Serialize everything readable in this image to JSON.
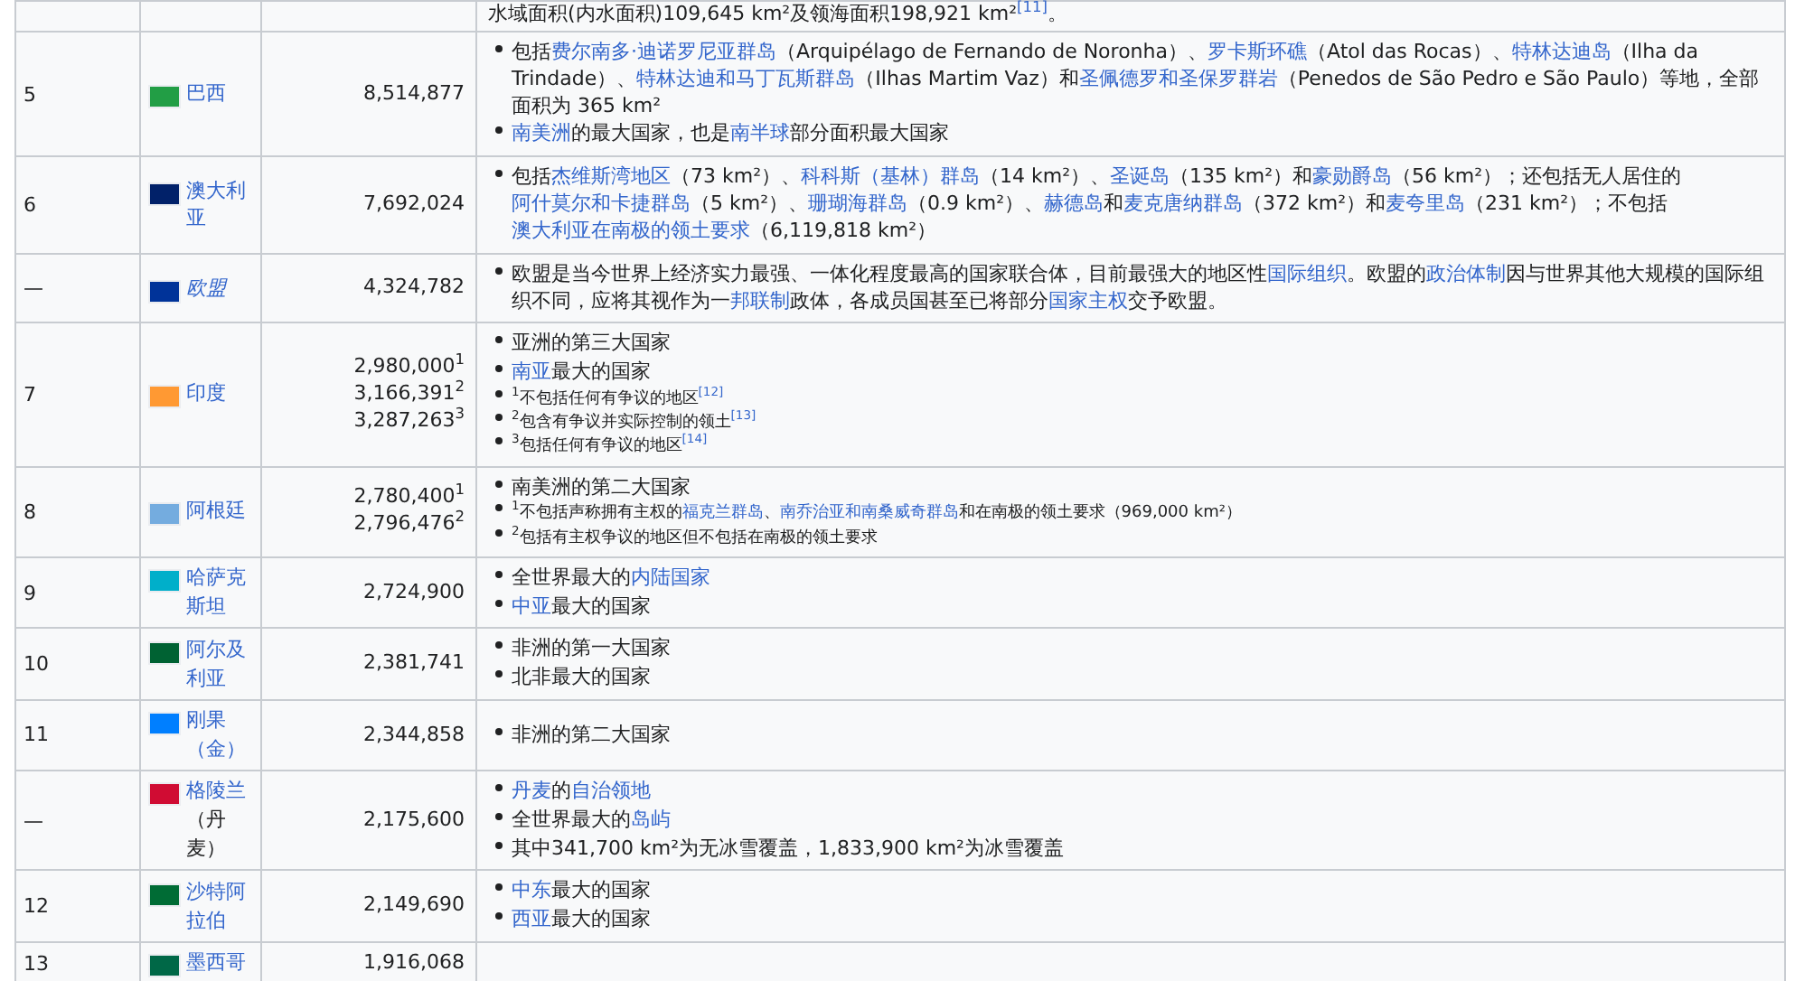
{
  "top_cut": {
    "parts": [
      {
        "text": "水域面积(内水面积)109,645 km²及领海面积198,921 km²",
        "link": false
      },
      {
        "text": "$^{[11]}$",
        "link": true
      },
      {
        "text": "。",
        "link": false
      }
    ]
  },
  "rows": [
    {
      "rank": "5",
      "color": "#229e45",
      "italic": false,
      "name": [
        {
          "text": "巴西",
          "link": true
        }
      ],
      "area": [
        "8,514,877"
      ],
      "notes": [
        {
          "kind": "normal",
          "parts": [
            {
              "text": "包括",
              "link": false
            },
            {
              "text": "费尔南多·迪诺罗尼亚群岛",
              "link": true
            },
            {
              "text": "（Arquipélago de Fernando de Noronha）、",
              "link": false
            },
            {
              "text": "罗卡斯环礁",
              "link": true
            },
            {
              "text": "（Atol das Rocas）、",
              "link": false
            },
            {
              "text": "特林达迪岛",
              "link": true
            },
            {
              "text": "（Ilha da Trindade）、",
              "link": false
            },
            {
              "text": "特林达迪和马丁瓦斯群岛",
              "link": true
            },
            {
              "text": "（Ilhas Martim Vaz）和",
              "link": false
            },
            {
              "text": "圣佩德罗和圣保罗群岩",
              "link": true
            },
            {
              "text": "（Penedos de São Pedro e São Paulo）等地，全部面积为 365 km²",
              "link": false
            }
          ]
        },
        {
          "kind": "normal",
          "parts": [
            {
              "text": "南美洲",
              "link": true
            },
            {
              "text": "的最大国家，也是",
              "link": false
            },
            {
              "text": "南半球",
              "link": true
            },
            {
              "text": "部分面积最大国家",
              "link": false
            }
          ]
        }
      ]
    },
    {
      "rank": "6",
      "color": "#012169",
      "italic": false,
      "name": [
        {
          "text": "澳大利亚",
          "link": true
        }
      ],
      "area": [
        "7,692,024"
      ],
      "notes": [
        {
          "kind": "normal",
          "parts": [
            {
              "text": "包括",
              "link": false
            },
            {
              "text": "杰维斯湾地区",
              "link": true
            },
            {
              "text": "（73 km²）、",
              "link": false
            },
            {
              "text": "科科斯（基林）群岛",
              "link": true
            },
            {
              "text": "（14 km²）、",
              "link": false
            },
            {
              "text": "圣诞岛",
              "link": true
            },
            {
              "text": "（135 km²）和",
              "link": false
            },
            {
              "text": "豪勋爵岛",
              "link": true
            },
            {
              "text": "（56 km²）；还包括无人居住的",
              "link": false
            },
            {
              "text": "阿什莫尔和卡捷群岛",
              "link": true
            },
            {
              "text": "（5 km²）、",
              "link": false
            },
            {
              "text": "珊瑚海群岛",
              "link": true
            },
            {
              "text": "（0.9 km²）、",
              "link": false
            },
            {
              "text": "赫德岛",
              "link": true
            },
            {
              "text": "和",
              "link": false
            },
            {
              "text": "麦克唐纳群岛",
              "link": true
            },
            {
              "text": "（372 km²）和",
              "link": false
            },
            {
              "text": "麦夸里岛",
              "link": true
            },
            {
              "text": "（231 km²）；不包括",
              "link": false
            },
            {
              "text": "澳大利亚在南极的领土要求",
              "link": true
            },
            {
              "text": "（6,119,818 km²）",
              "link": false
            }
          ]
        }
      ]
    },
    {
      "rank": "—",
      "color": "#003399",
      "italic": true,
      "name": [
        {
          "text": "欧盟",
          "link": true
        }
      ],
      "area": [
        "4,324,782"
      ],
      "notes": [
        {
          "kind": "normal",
          "parts": [
            {
              "text": "欧盟是当今世界上经济实力最强、一体化程度最高的国家联合体，目前最强大的地区性",
              "link": false
            },
            {
              "text": "国际组织",
              "link": true
            },
            {
              "text": "。欧盟的",
              "link": false
            },
            {
              "text": "政治体制",
              "link": true
            },
            {
              "text": "因与世界其他大规模的国际组织不同，应将其视作为一",
              "link": false
            },
            {
              "text": "邦联制",
              "link": true
            },
            {
              "text": "政体，各成员国甚至已将部分",
              "link": false
            },
            {
              "text": "国家主权",
              "link": true
            },
            {
              "text": "交予欧盟。",
              "link": false
            }
          ]
        }
      ]
    },
    {
      "rank": "7",
      "color": "#ff9933",
      "italic": false,
      "name": [
        {
          "text": "印度",
          "link": true
        }
      ],
      "area": [
        "2,980,000$^{1}$",
        "3,166,391$^{2}$",
        "3,287,263$^{3}$"
      ],
      "notes": [
        {
          "kind": "normal",
          "parts": [
            {
              "text": "亚洲的第三大国家",
              "link": false
            }
          ]
        },
        {
          "kind": "normal",
          "parts": [
            {
              "text": "南亚",
              "link": true
            },
            {
              "text": "最大的国家",
              "link": false
            }
          ]
        },
        {
          "kind": "small",
          "parts": [
            {
              "text": "$^{1}$不包括任何有争议的地区",
              "link": false
            },
            {
              "text": "$^{[12]}$",
              "link": true
            }
          ]
        },
        {
          "kind": "small",
          "parts": [
            {
              "text": "$^{2}$包含有争议并实际控制的领土",
              "link": false
            },
            {
              "text": "$^{[13]}$",
              "link": true
            }
          ]
        },
        {
          "kind": "small",
          "parts": [
            {
              "text": "$^{3}$包括任何有争议的地区",
              "link": false
            },
            {
              "text": "$^{[14]}$",
              "link": true
            }
          ]
        }
      ]
    },
    {
      "rank": "8",
      "color": "#74acdf",
      "italic": false,
      "name": [
        {
          "text": "阿根廷",
          "link": true
        }
      ],
      "area": [
        "2,780,400$^{1}$",
        "2,796,476$^{2}$"
      ],
      "notes": [
        {
          "kind": "normal",
          "parts": [
            {
              "text": "南美洲的第二大国家",
              "link": false
            }
          ]
        },
        {
          "kind": "small",
          "parts": [
            {
              "text": "$^{1}$不包括声称拥有主权的",
              "link": false
            },
            {
              "text": "福克兰群岛",
              "link": true
            },
            {
              "text": "、",
              "link": false
            },
            {
              "text": "南乔治亚和南桑威奇群岛",
              "link": true
            },
            {
              "text": "和在南极的领土要求（969,000 km²）",
              "link": false
            }
          ]
        },
        {
          "kind": "small",
          "parts": [
            {
              "text": "$^{2}$包括有主权争议的地区但不包括在南极的领土要求",
              "link": false
            }
          ]
        }
      ]
    },
    {
      "rank": "9",
      "color": "#00afca",
      "italic": false,
      "name": [
        {
          "text": "哈萨克斯坦",
          "link": true
        }
      ],
      "area": [
        "2,724,900"
      ],
      "notes": [
        {
          "kind": "normal",
          "parts": [
            {
              "text": "全世界最大的",
              "link": false
            },
            {
              "text": "内陆国家",
              "link": true
            }
          ]
        },
        {
          "kind": "normal",
          "parts": [
            {
              "text": "中亚",
              "link": true
            },
            {
              "text": "最大的国家",
              "link": false
            }
          ]
        }
      ]
    },
    {
      "rank": "10",
      "color": "#006233",
      "italic": false,
      "name": [
        {
          "text": "阿尔及利亚",
          "link": true
        }
      ],
      "area": [
        "2,381,741"
      ],
      "notes": [
        {
          "kind": "normal",
          "parts": [
            {
              "text": "非洲的第一大国家",
              "link": false
            }
          ]
        },
        {
          "kind": "normal",
          "parts": [
            {
              "text": "北非最大的国家",
              "link": false
            }
          ]
        }
      ]
    },
    {
      "rank": "11",
      "color": "#007fff",
      "italic": false,
      "name": [
        {
          "text": "刚果（金）",
          "link": true
        }
      ],
      "area": [
        "2,344,858"
      ],
      "notes": [
        {
          "kind": "normal",
          "parts": [
            {
              "text": "非洲的第二大国家",
              "link": false
            }
          ]
        }
      ]
    },
    {
      "rank": "—",
      "color": "#d00c33",
      "italic": false,
      "name": [
        {
          "text": "格陵兰",
          "link": true
        },
        {
          "text": "（丹麦）",
          "link": false
        }
      ],
      "area": [
        "2,175,600"
      ],
      "notes": [
        {
          "kind": "normal",
          "parts": [
            {
              "text": "丹麦",
              "link": true
            },
            {
              "text": "的",
              "link": false
            },
            {
              "text": "自治领地",
              "link": true
            }
          ]
        },
        {
          "kind": "normal",
          "parts": [
            {
              "text": "全世界最大的",
              "link": false
            },
            {
              "text": "岛屿",
              "link": true
            }
          ]
        },
        {
          "kind": "normal",
          "parts": [
            {
              "text": "其中341,700 km²为无冰雪覆盖，1,833,900 km²为冰雪覆盖",
              "link": false
            }
          ]
        }
      ]
    },
    {
      "rank": "12",
      "color": "#006c35",
      "italic": false,
      "name": [
        {
          "text": "沙特阿拉伯",
          "link": true
        }
      ],
      "area": [
        "2,149,690"
      ],
      "notes": [
        {
          "kind": "normal",
          "parts": [
            {
              "text": "中东",
              "link": true
            },
            {
              "text": "最大的国家",
              "link": false
            }
          ]
        },
        {
          "kind": "normal",
          "parts": [
            {
              "text": "西亚",
              "link": true
            },
            {
              "text": "最大的国家",
              "link": false
            }
          ]
        }
      ]
    },
    {
      "rank": "13",
      "color": "#006847",
      "italic": false,
      "name": [
        {
          "text": "墨西哥",
          "link": true
        }
      ],
      "area": [
        "1,916,068"
      ],
      "notes": []
    }
  ]
}
